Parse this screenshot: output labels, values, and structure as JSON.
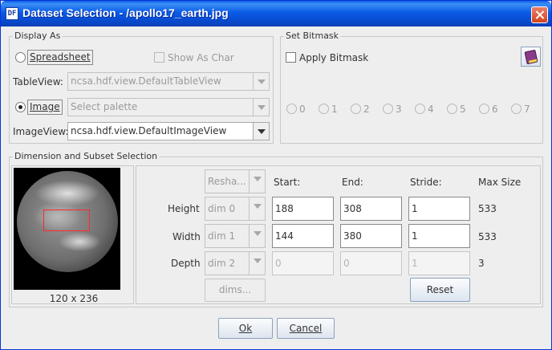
{
  "window": {
    "title": "Dataset Selection - /apollo17_earth.jpg",
    "app_icon_text": "DF"
  },
  "display_as": {
    "group_label": "Display As",
    "spreadsheet_label": "Spreadsheet",
    "show_as_char_label": "Show As Char",
    "tableview_label": "TableView:",
    "tableview_value": "ncsa.hdf.view.DefaultTableView",
    "image_label": "Image",
    "palette_value": "Select palette",
    "imageview_label": "ImageView:",
    "imageview_value": "ncsa.hdf.view.DefaultImageView"
  },
  "bitmask": {
    "group_label": "Set Bitmask",
    "apply_label": "Apply Bitmask",
    "bits": [
      "0",
      "1",
      "2",
      "3",
      "4",
      "5",
      "6",
      "7"
    ]
  },
  "dimension": {
    "group_label": "Dimension and Subset Selection",
    "reshape_value": "Resha...",
    "headers": {
      "start": "Start:",
      "end": "End:",
      "stride": "Stride:",
      "max": "Max Size"
    },
    "rows": [
      {
        "label": "Height",
        "dim": "dim 0",
        "start": "188",
        "end": "308",
        "stride": "1",
        "max": "533"
      },
      {
        "label": "Width",
        "dim": "dim 1",
        "start": "144",
        "end": "380",
        "stride": "1",
        "max": "533"
      },
      {
        "label": "Depth",
        "dim": "dim 2",
        "start": "0",
        "end": "0",
        "stride": "1",
        "max": "3"
      }
    ],
    "dims_button": "dims...",
    "reset_button": "Reset",
    "preview_caption": "120 x 236"
  },
  "footer": {
    "ok_label": "Ok",
    "cancel_label": "Cancel"
  }
}
